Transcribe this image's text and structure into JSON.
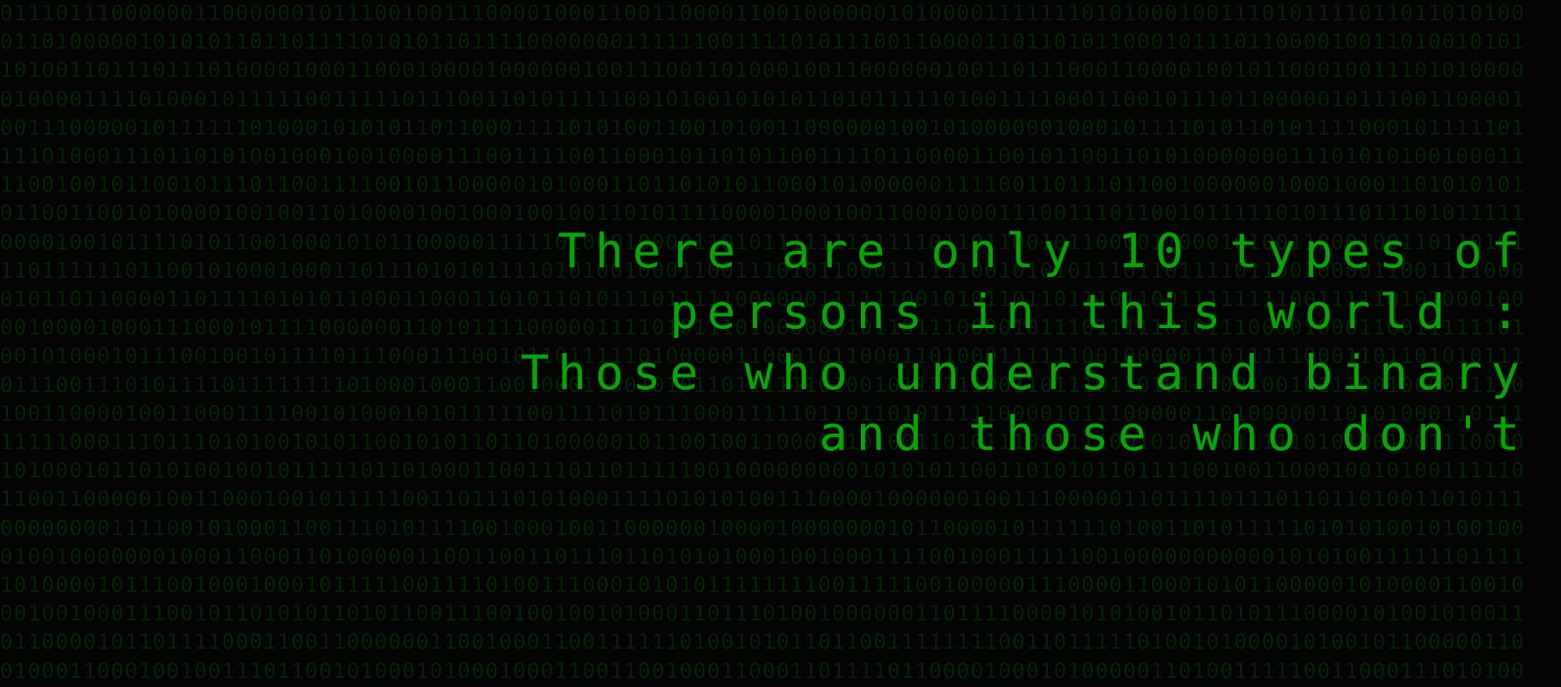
{
  "wallpaper": {
    "message_lines": [
      "There are only 10 types of",
      "persons in this world :",
      "Those who understand binary",
      "and those who don't"
    ],
    "text_color": "#0fa00f",
    "background_digit_color": "#0b3a0b",
    "background_color": "#040404"
  }
}
